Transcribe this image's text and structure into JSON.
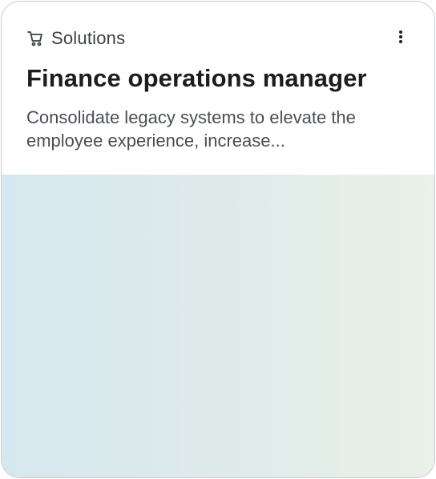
{
  "card": {
    "category": {
      "icon": "cart-icon",
      "label": "Solutions"
    },
    "menu_icon": "more-vertical-icon",
    "title": "Finance operations manager",
    "description": "Consolidate legacy systems to elevate the employee experience, increase..."
  },
  "colors": {
    "border": "#c9cccf",
    "title_text": "#1b1d20",
    "body_text": "#4a4e53",
    "media_gradient_start": "#d6e8ef",
    "media_gradient_end": "#e9f1e8"
  }
}
